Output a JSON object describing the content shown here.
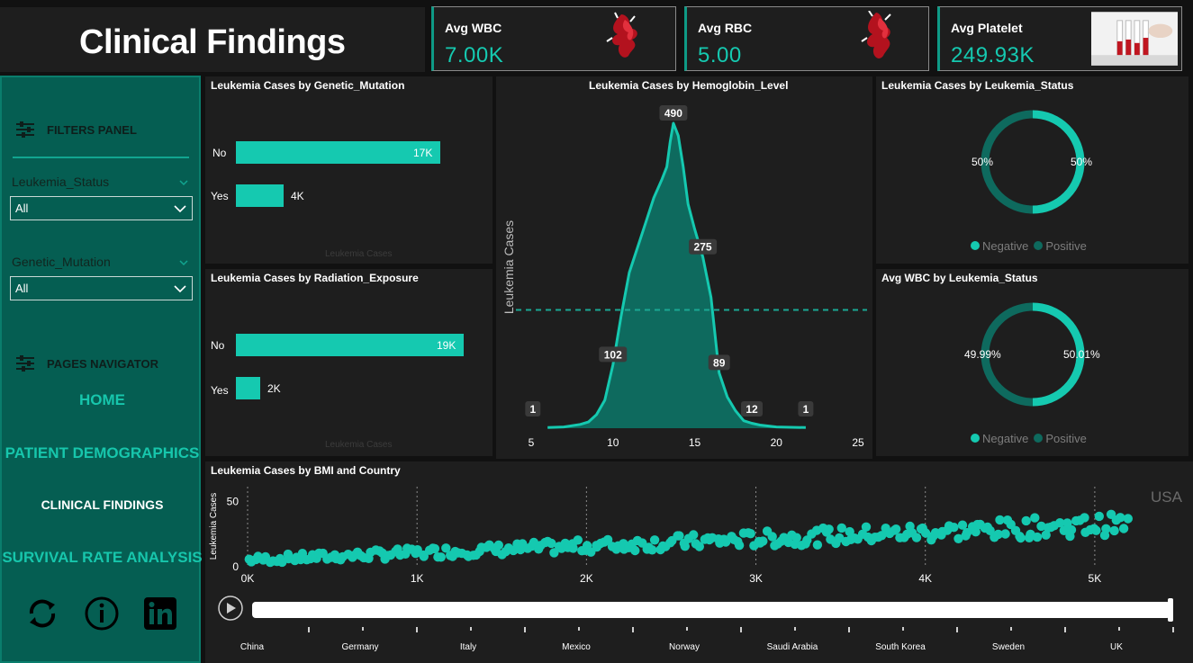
{
  "header": {
    "title": "Clinical Findings"
  },
  "kpis": [
    {
      "label": "Avg WBC",
      "value": "7.00K",
      "image": "blood-splash-image"
    },
    {
      "label": "Avg RBC",
      "value": "5.00",
      "image": "blood-splash-image"
    },
    {
      "label": "Avg Platelet",
      "value": "249.93K",
      "image": "blood-test-tubes-image"
    }
  ],
  "sidebar": {
    "filters_heading": "FILTERS PANEL",
    "filters": [
      {
        "label": "Leukemia_Status",
        "selected": "All"
      },
      {
        "label": "Genetic_Mutation",
        "selected": "All"
      }
    ],
    "pages_heading": "PAGES NAVIGATOR",
    "nav": [
      {
        "label": "HOME",
        "active": false
      },
      {
        "label": "PATIENT DEMOGRAPHICS",
        "active": false
      },
      {
        "label": "CLINICAL FINDINGS",
        "active": true
      },
      {
        "label": "SURVIVAL RATE ANALYSIS",
        "active": false
      }
    ],
    "icons": [
      "refresh-icon",
      "info-icon",
      "linkedin-icon"
    ]
  },
  "colors": {
    "accent": "#15c9b0",
    "dark_accent": "#0e6a5e",
    "sidebar": "#055e52",
    "panel": "#1e1e1e"
  },
  "chart_data": [
    {
      "type": "bar",
      "title": "Leukemia Cases by Genetic_Mutation",
      "categories": [
        "No",
        "Yes"
      ],
      "values": [
        17000,
        4000
      ],
      "value_labels": [
        "17K",
        "4K"
      ],
      "xlabel": "Leukemia Cases"
    },
    {
      "type": "bar",
      "title": "Leukemia Cases by Radiation_Exposure",
      "categories": [
        "No",
        "Yes"
      ],
      "values": [
        19000,
        2000
      ],
      "value_labels": [
        "19K",
        "2K"
      ],
      "xlabel": "Leukemia Cases"
    },
    {
      "type": "area",
      "title": "Leukemia Cases by Hemoglobin_Level",
      "ylabel": "Leukemia Cases",
      "xlim": [
        5,
        25
      ],
      "x_ticks": [
        "5",
        "10",
        "15",
        "20",
        "25"
      ],
      "reference_line_y": 190,
      "points": [
        [
          6.0,
          1
        ],
        [
          7.0,
          2
        ],
        [
          8.0,
          6
        ],
        [
          8.5,
          10
        ],
        [
          9.0,
          22
        ],
        [
          9.5,
          45
        ],
        [
          10.0,
          102
        ],
        [
          10.5,
          180
        ],
        [
          11.0,
          250
        ],
        [
          11.5,
          290
        ],
        [
          12.0,
          330
        ],
        [
          12.5,
          370
        ],
        [
          13.0,
          400
        ],
        [
          13.3,
          420
        ],
        [
          13.5,
          460
        ],
        [
          13.7,
          490
        ],
        [
          14.0,
          470
        ],
        [
          14.3,
          420
        ],
        [
          14.6,
          360
        ],
        [
          15.0,
          320
        ],
        [
          15.5,
          275
        ],
        [
          16.0,
          210
        ],
        [
          16.5,
          89
        ],
        [
          17.0,
          50
        ],
        [
          17.5,
          28
        ],
        [
          18.0,
          12
        ],
        [
          18.5,
          8
        ],
        [
          19.0,
          5
        ],
        [
          20.0,
          2
        ],
        [
          21.8,
          1
        ]
      ],
      "annotations": [
        {
          "x": 5.1,
          "y": 1,
          "label": "1"
        },
        {
          "x": 10.0,
          "y": 102,
          "label": "102"
        },
        {
          "x": 13.7,
          "y": 490,
          "label": "490"
        },
        {
          "x": 15.5,
          "y": 275,
          "label": "275"
        },
        {
          "x": 16.5,
          "y": 89,
          "label": "89"
        },
        {
          "x": 18.5,
          "y": 12,
          "label": "12"
        },
        {
          "x": 21.8,
          "y": 1,
          "label": "1"
        }
      ]
    },
    {
      "type": "pie",
      "title": "Leukemia Cases by Leukemia_Status",
      "labels": [
        "Negative",
        "Positive"
      ],
      "values": [
        50,
        50
      ],
      "value_labels": [
        "50%",
        "50%"
      ],
      "legend": [
        "Negative",
        "Positive"
      ]
    },
    {
      "type": "pie",
      "title": "Avg WBC by Leukemia_Status",
      "labels": [
        "Negative",
        "Positive"
      ],
      "values": [
        50.01,
        49.99
      ],
      "value_labels": [
        "50.01%",
        "49.99%"
      ],
      "legend": [
        "Negative",
        "Positive"
      ]
    },
    {
      "type": "scatter",
      "title": "Leukemia Cases by BMI and Country",
      "ylabel": "Leukemia Cases",
      "x_ticks": [
        "0K",
        "1K",
        "2K",
        "3K",
        "4K",
        "5K"
      ],
      "y_ticks": [
        "0",
        "50"
      ],
      "xlim": [
        0,
        5500
      ],
      "ylim": [
        0,
        60
      ],
      "current_frame": "USA",
      "trend": {
        "x_start": 0,
        "y_start": 5,
        "x_end": 5200,
        "y_end": 32
      }
    }
  ],
  "timeline": {
    "play_icon": "play-icon",
    "countries": [
      "China",
      "Germany",
      "Italy",
      "Mexico",
      "Norway",
      "Saudi Arabia",
      "South Korea",
      "Sweden",
      "UK"
    ]
  }
}
